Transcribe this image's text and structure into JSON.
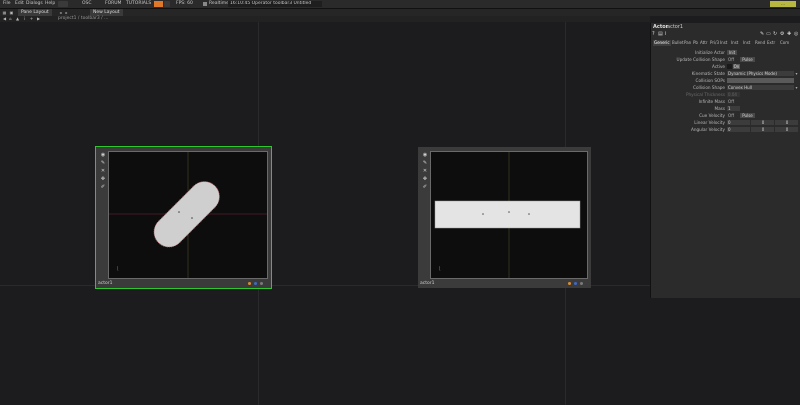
{
  "menubar": {
    "items": [
      "File",
      "Edit",
      "Dialogs",
      "Help"
    ],
    "links": [
      "OSC",
      "FORUM",
      "TUTORIALS"
    ],
    "fps": "FPS: 60",
    "realtime_label": "Realtime",
    "status": "16:10:45 Operator toolbar3 Untitled",
    "accent": "#e0782a",
    "right_badge": "..."
  },
  "toolbar2": {
    "pane_tab": "Pane Layout",
    "new_layout": "New Layout"
  },
  "pathbar": {
    "path": "project1 / toolbar3 / ..."
  },
  "nodes": [
    {
      "label": "actor1",
      "selected": true,
      "shape": "capsule"
    },
    {
      "label": "actor1",
      "selected": false,
      "shape": "box"
    }
  ],
  "panel": {
    "title": "Actor",
    "op_name": "actor1",
    "tabs": [
      "Generic",
      "Bullet",
      "Pan",
      "Pb",
      "Attr",
      "Pri/3",
      "Inst",
      "Inst",
      "Inst",
      "Rend",
      "Extr",
      "Com"
    ],
    "params": [
      {
        "label": "Initialize Actor",
        "field": "Init",
        "kind": "button"
      },
      {
        "label": "Update Collision Shape",
        "field": "Off",
        "extra": "Pulse",
        "kind": "toggle"
      },
      {
        "label": "Active",
        "field": "On",
        "kind": "on"
      },
      {
        "label": "Kinematic State",
        "field": "Dynamic (Physics Mode)",
        "kind": "menu"
      },
      {
        "label": "Collision SOPs",
        "field": "",
        "kind": "text"
      },
      {
        "label": "Collision Shape",
        "field": "Convex Hull",
        "kind": "menu"
      },
      {
        "label": "Physical Thickness",
        "field": "0.04",
        "kind": "dim"
      },
      {
        "label": "Infinite Mass",
        "field": "Off",
        "kind": "toggle"
      },
      {
        "label": "Mass",
        "field": "1",
        "kind": "num"
      },
      {
        "label": "Cue Velocity",
        "field": "Off",
        "extra": "Pulse",
        "kind": "toggle"
      },
      {
        "label": "Linear Velocity",
        "values": [
          "0",
          "0",
          "0"
        ],
        "kind": "vec"
      },
      {
        "label": "Angular Velocity",
        "values": [
          "0",
          "0",
          "0"
        ],
        "kind": "vec"
      }
    ]
  },
  "colors": {
    "selected_outline": "#2ec82e",
    "background": "#1c1c1e",
    "panel": "#2b2b2b"
  }
}
